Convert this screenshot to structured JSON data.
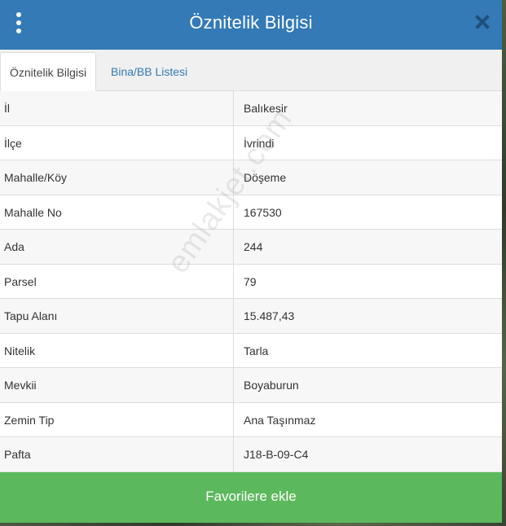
{
  "header": {
    "title": "Öznitelik Bilgisi",
    "background": "#337ab7"
  },
  "tabs": [
    {
      "label": "Öznitelik Bilgisi",
      "active": true
    },
    {
      "label": "Bina/BB Listesi",
      "active": false
    }
  ],
  "attributes": [
    {
      "key": "İl",
      "value": "Balıkesir"
    },
    {
      "key": "İlçe",
      "value": "İvrindi"
    },
    {
      "key": "Mahalle/Köy",
      "value": "Döşeme"
    },
    {
      "key": "Mahalle No",
      "value": "167530"
    },
    {
      "key": "Ada",
      "value": "244"
    },
    {
      "key": "Parsel",
      "value": "79"
    },
    {
      "key": "Tapu Alanı",
      "value": "15.487,43"
    },
    {
      "key": "Nitelik",
      "value": "Tarla"
    },
    {
      "key": "Mevkii",
      "value": "Boyaburun"
    },
    {
      "key": "Zemin Tip",
      "value": "Ana Taşınmaz"
    },
    {
      "key": "Pafta",
      "value": "J18-B-09-C4"
    }
  ],
  "footer": {
    "button_label": "Favorilere ekle",
    "button_color": "#5cb85c"
  },
  "watermark": "emlakjet.com",
  "icons": {
    "menu": "vertical-dots-icon",
    "close": "close-icon"
  }
}
